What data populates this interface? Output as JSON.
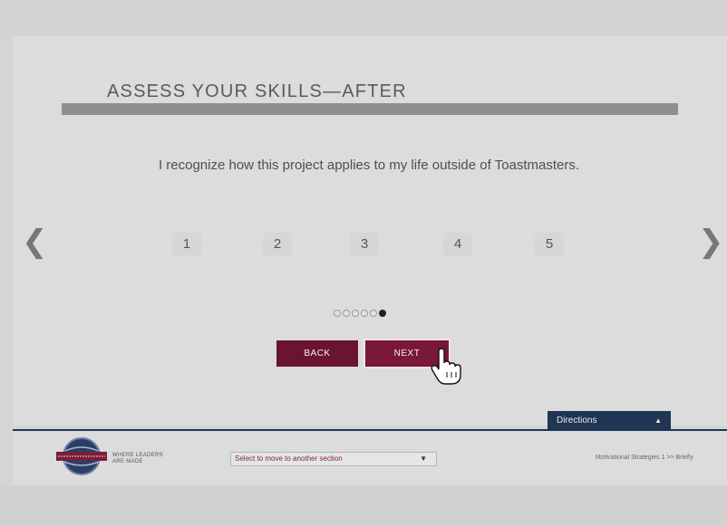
{
  "assessment": {
    "title": "ASSESS YOUR SKILLS—AFTER",
    "question": "I recognize how this project applies to my life outside of Toastmasters.",
    "scale": [
      "1",
      "2",
      "3",
      "4",
      "5"
    ],
    "prev_arrow": "❮",
    "next_arrow": "❯",
    "progress": {
      "total": 6,
      "current": 6
    }
  },
  "buttons": {
    "back_label": "BACK",
    "next_label": "NEXT"
  },
  "directions": {
    "label": "Directions",
    "caret": "▲"
  },
  "footer": {
    "tagline_line1": "WHERE LEADERS",
    "tagline_line2": "ARE MADE",
    "section_select": "Select to move to another section",
    "select_caret": "▼",
    "path_label": "Motivational Strategies 1 >> Briefly"
  },
  "colors": {
    "accent": "#7a1838",
    "navy": "#1e3555",
    "title_bar": "#8e8e8e"
  }
}
